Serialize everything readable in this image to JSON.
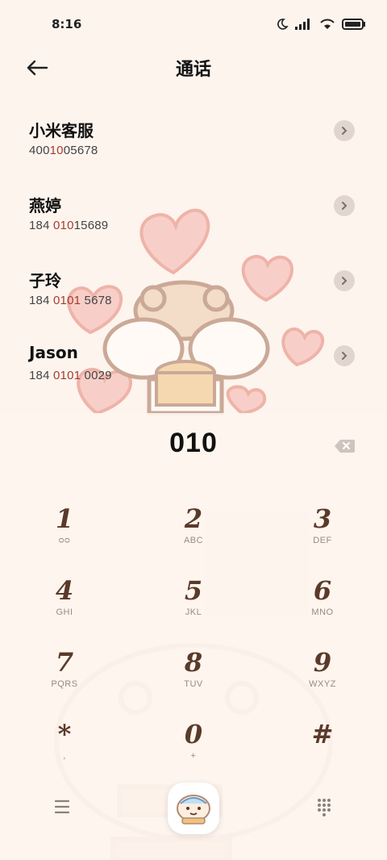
{
  "status": {
    "time": "8:16"
  },
  "header": {
    "title": "通话"
  },
  "contacts": [
    {
      "name": "小米客服",
      "num_pre": "400",
      "num_hl": "10",
      "num_post": "05678"
    },
    {
      "name": "燕婷",
      "num_pre": "184 ",
      "num_hl": "010",
      "num_post": "15689"
    },
    {
      "name": "子玲",
      "num_pre": "184 ",
      "num_hl": "0101",
      "num_post": " 5678"
    },
    {
      "name": "Jason",
      "num_pre": "184 ",
      "num_hl": "0101",
      "num_post": " 0029"
    }
  ],
  "dialer": {
    "display": "010",
    "keys": [
      {
        "digit": "1",
        "letters": "ᴑᴑ"
      },
      {
        "digit": "2",
        "letters": "ABC"
      },
      {
        "digit": "3",
        "letters": "DEF"
      },
      {
        "digit": "4",
        "letters": "GHI"
      },
      {
        "digit": "5",
        "letters": "JKL"
      },
      {
        "digit": "6",
        "letters": "MNO"
      },
      {
        "digit": "7",
        "letters": "PQRS"
      },
      {
        "digit": "8",
        "letters": "TUV"
      },
      {
        "digit": "9",
        "letters": "WXYZ"
      },
      {
        "digit": "*",
        "letters": ","
      },
      {
        "digit": "0",
        "letters": "+"
      },
      {
        "digit": "#",
        "letters": ""
      }
    ]
  },
  "icons": {
    "back": "arrow-left-icon",
    "chevron": "chevron-right-icon",
    "backspace": "backspace-icon",
    "menu": "menu-icon",
    "call": "call-hamster-icon",
    "keypad": "keypad-icon"
  },
  "colors": {
    "background": "#fdf4ee",
    "highlight": "#a63c2d",
    "key_digit": "#5a3a2a"
  }
}
